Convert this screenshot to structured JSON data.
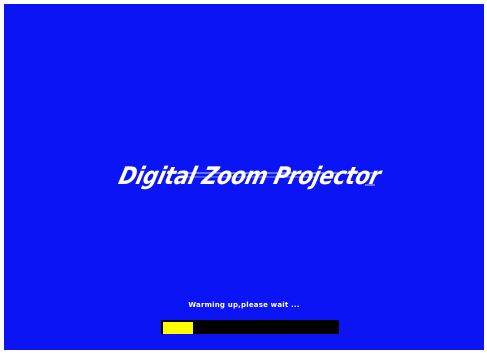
{
  "logo": {
    "text": "Digital Zoom Projector"
  },
  "status": {
    "message": "Warming up,please wait ..."
  },
  "progress": {
    "fraction": 0.16
  },
  "colors": {
    "background": "#0a14f5",
    "text": "#ffffff",
    "progress_track": "#000000",
    "progress_fill": "#ffff00"
  }
}
